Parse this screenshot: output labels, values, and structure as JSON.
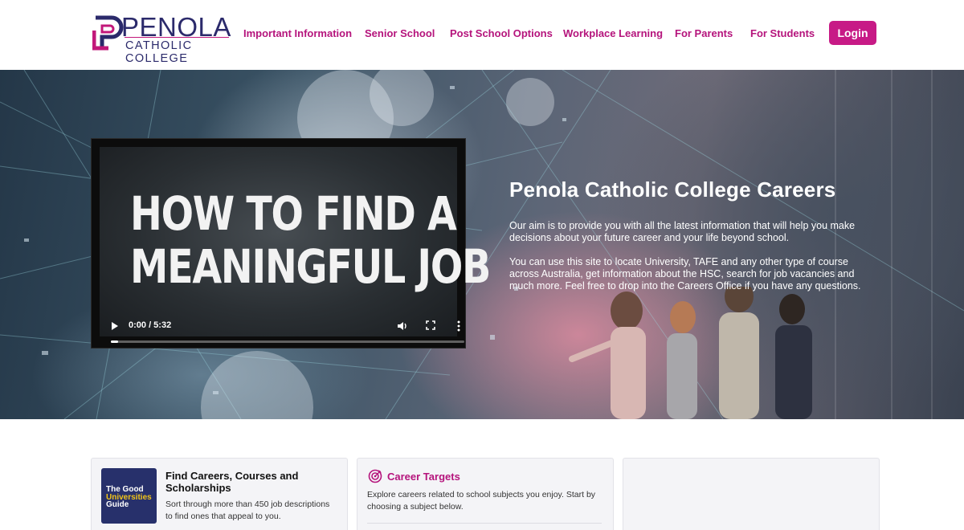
{
  "brand": {
    "name": "PENOLA",
    "subtitle": "CATHOLIC COLLEGE",
    "primary_color": "#c71a86",
    "navy_color": "#2b2a6b"
  },
  "nav": {
    "items": [
      {
        "label": "Important Information"
      },
      {
        "label": "Senior School"
      },
      {
        "label": "Post School Options"
      },
      {
        "label": "Workplace Learning"
      },
      {
        "label": "For Parents"
      },
      {
        "label": "For Students"
      }
    ],
    "login_label": "Login"
  },
  "hero": {
    "title": "Penola Catholic College Careers",
    "paragraphs": [
      "Our aim is to provide you with all the latest information that will help you make decisions about your future career and your life beyond school.",
      "You can use this site to locate University, TAFE and any other type of course across Australia, get information about the HSC, search for job vacancies and much more. Feel free to drop into the Careers Office if you have any questions."
    ],
    "video": {
      "title_line1": "HOW TO FIND A",
      "title_line2": "MEANINGFUL JOB",
      "time": "0:00 / 5:32",
      "progress": 0.02,
      "icons": [
        "play-icon",
        "volume-icon",
        "fullscreen-icon",
        "more-options-icon"
      ]
    }
  },
  "cards": [
    {
      "badge_lines": [
        "The Good",
        "Universities",
        "Guide"
      ],
      "title": "Find Careers, Courses and Scholarships",
      "text": "Sort through more than 450 job descriptions to find ones that appeal to you."
    },
    {
      "icon": "target-icon",
      "title": "Career Targets",
      "text": "Explore careers related to school subjects you enjoy. Start by choosing a subject below."
    },
    {}
  ]
}
